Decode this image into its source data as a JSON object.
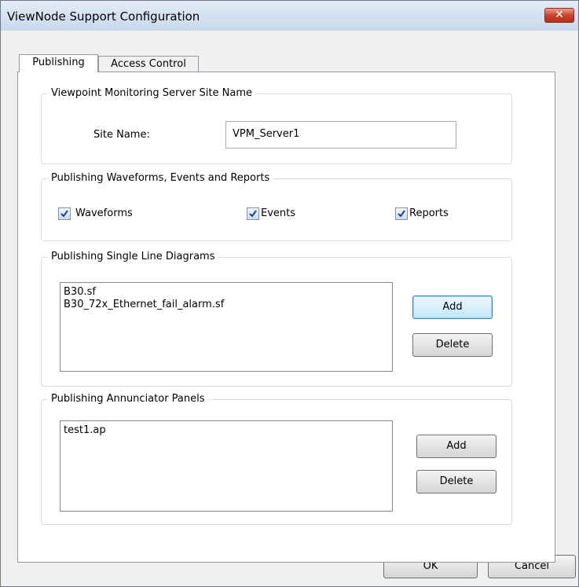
{
  "window": {
    "title": "ViewNode Support Configuration",
    "close_glyph": "✕"
  },
  "tabs": [
    {
      "label": "Publishing"
    },
    {
      "label": "Access Control"
    }
  ],
  "site_group": {
    "title": "Viewpoint Monitoring Server Site Name",
    "site_label": "Site Name:",
    "site_value": "VPM_Server1"
  },
  "publish_group": {
    "title": "Publishing Waveforms, Events and Reports",
    "checks": [
      {
        "label": "Waveforms",
        "checked": true
      },
      {
        "label": "Events",
        "checked": true
      },
      {
        "label": "Reports",
        "checked": true
      }
    ]
  },
  "sld_group": {
    "title": "Publishing Single Line Diagrams",
    "items": [
      "B30.sf",
      "B30_72x_Ethernet_fail_alarm.sf"
    ],
    "add_label": "Add",
    "delete_label": "Delete"
  },
  "ann_group": {
    "title": "Publishing Annunciator Panels",
    "items": [
      "test1.ap"
    ],
    "add_label": "Add",
    "delete_label": "Delete"
  },
  "footer": {
    "ok_label": "OK",
    "cancel_label": "Cancel"
  }
}
